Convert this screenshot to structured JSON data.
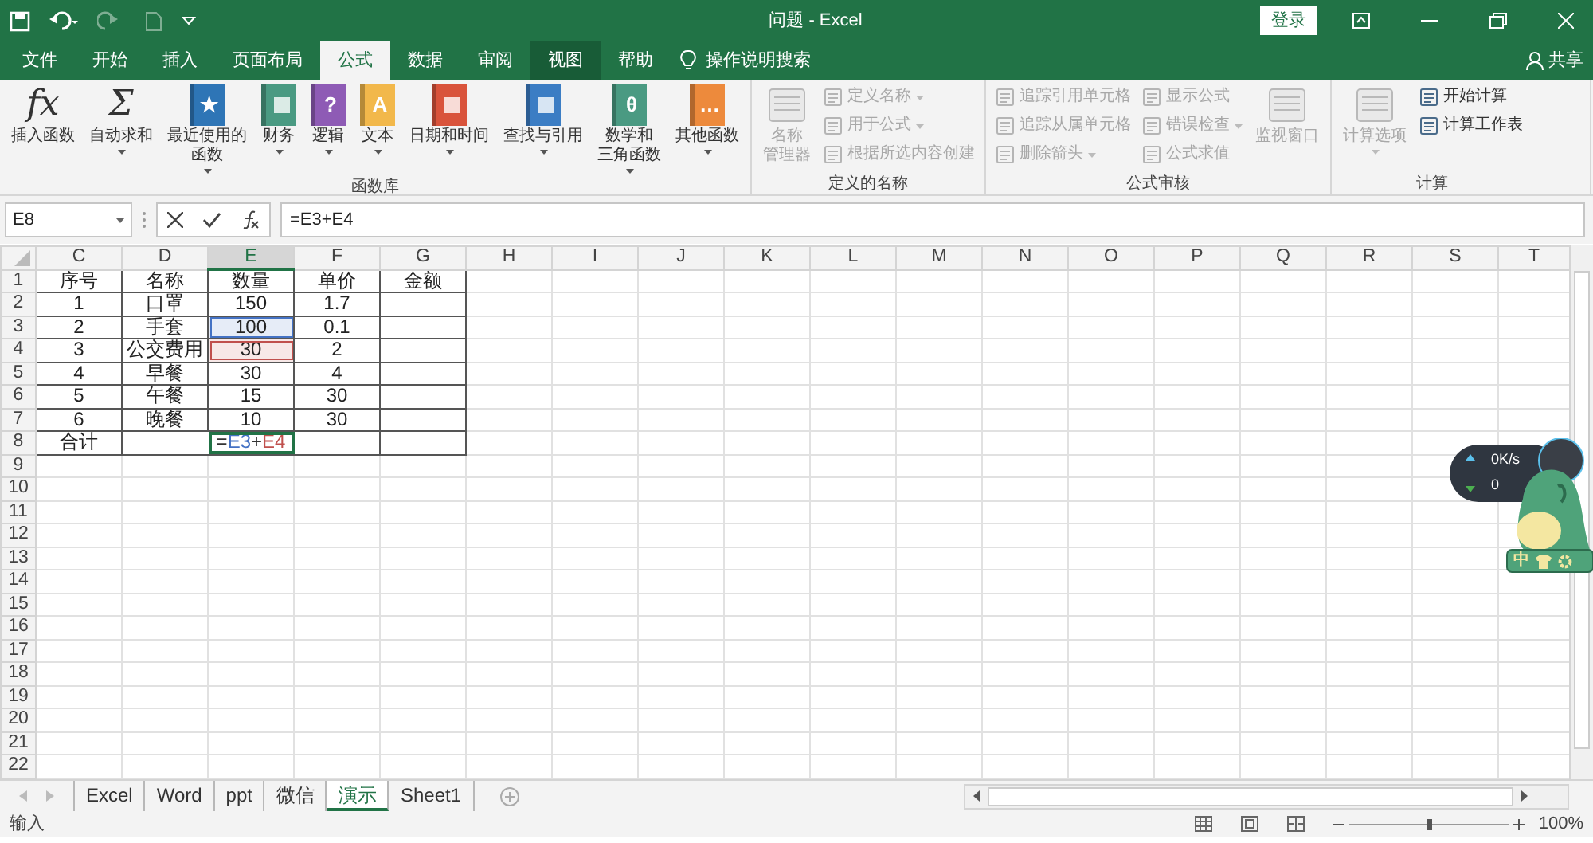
{
  "window": {
    "title": "问题 - Excel",
    "login": "登录"
  },
  "tabs": [
    {
      "label": "文件",
      "selected": false,
      "hovered": false
    },
    {
      "label": "开始",
      "selected": false,
      "hovered": false
    },
    {
      "label": "插入",
      "selected": false,
      "hovered": false
    },
    {
      "label": "页面布局",
      "selected": false,
      "hovered": false
    },
    {
      "label": "公式",
      "selected": true,
      "hovered": false
    },
    {
      "label": "数据",
      "selected": false,
      "hovered": false
    },
    {
      "label": "审阅",
      "selected": false,
      "hovered": false
    },
    {
      "label": "视图",
      "selected": false,
      "hovered": true
    },
    {
      "label": "帮助",
      "selected": false,
      "hovered": false
    }
  ],
  "tell_me": "操作说明搜索",
  "share": "共享",
  "ribbon": {
    "groups": [
      {
        "label": "函数库",
        "buttons": [
          {
            "kind": "glyph",
            "glyph": "fx",
            "label_lines": [
              "插入函数"
            ],
            "dropdown": false,
            "disabled": false
          },
          {
            "kind": "glyph",
            "glyph": "Σ",
            "label_lines": [
              "自动求和"
            ],
            "dropdown": true,
            "disabled": false
          },
          {
            "kind": "book",
            "glyph": "★",
            "color": "#2e75b6",
            "label_lines": [
              "最近使用的",
              "函数"
            ],
            "dropdown": true,
            "disabled": false
          },
          {
            "kind": "book",
            "color": "#4a9a82",
            "label_lines": [
              "财务"
            ],
            "dropdown": true,
            "disabled": false
          },
          {
            "kind": "book",
            "glyph": "?",
            "color": "#8e5bb5",
            "label_lines": [
              "逻辑"
            ],
            "dropdown": true,
            "disabled": false
          },
          {
            "kind": "book",
            "glyph": "A",
            "color": "#f2b84b",
            "label_lines": [
              "文本"
            ],
            "dropdown": true,
            "disabled": false
          },
          {
            "kind": "book",
            "color": "#d9533b",
            "label_lines": [
              "日期和时间"
            ],
            "dropdown": true,
            "disabled": false
          },
          {
            "kind": "book",
            "color": "#3b7dc4",
            "label_lines": [
              "查找与引用"
            ],
            "dropdown": true,
            "disabled": false
          },
          {
            "kind": "book",
            "glyph": "θ",
            "color": "#4a9a82",
            "label_lines": [
              "数学和",
              "三角函数"
            ],
            "dropdown": true,
            "disabled": false
          },
          {
            "kind": "book",
            "glyph": "…",
            "color": "#ed8a3c",
            "label_lines": [
              "其他函数"
            ],
            "dropdown": true,
            "disabled": false
          }
        ]
      },
      {
        "label": "定义的名称",
        "buttons": [
          {
            "kind": "large",
            "label_lines": [
              "名称",
              "管理器"
            ],
            "dropdown": false,
            "disabled": true
          },
          {
            "kind": "small",
            "label": "定义名称",
            "dropdown": true,
            "disabled": true
          },
          {
            "kind": "small",
            "label": "用于公式",
            "dropdown": true,
            "disabled": true
          },
          {
            "kind": "small",
            "label": "根据所选内容创建",
            "dropdown": false,
            "disabled": true
          }
        ]
      },
      {
        "label": "公式审核",
        "buttons": [
          {
            "kind": "small",
            "label": "追踪引用单元格",
            "dropdown": false,
            "disabled": true
          },
          {
            "kind": "small",
            "label": "追踪从属单元格",
            "dropdown": false,
            "disabled": true
          },
          {
            "kind": "small",
            "label": "删除箭头",
            "dropdown": true,
            "disabled": true
          },
          {
            "kind": "small",
            "label": "显示公式",
            "dropdown": false,
            "disabled": true
          },
          {
            "kind": "small",
            "label": "错误检查",
            "dropdown": true,
            "disabled": true
          },
          {
            "kind": "small",
            "label": "公式求值",
            "dropdown": false,
            "disabled": true
          },
          {
            "kind": "large",
            "label_lines": [
              "监视窗口"
            ],
            "dropdown": false,
            "disabled": true
          }
        ]
      },
      {
        "label": "计算",
        "buttons": [
          {
            "kind": "large",
            "label_lines": [
              "计算选项"
            ],
            "dropdown": true,
            "disabled": true
          },
          {
            "kind": "small",
            "label": "开始计算",
            "dropdown": false,
            "disabled": false
          },
          {
            "kind": "small",
            "label": "计算工作表",
            "dropdown": false,
            "disabled": false
          }
        ]
      }
    ]
  },
  "formula_bar": {
    "name_box": "E8",
    "formula": "=E3+E4"
  },
  "sheet": {
    "columns": [
      {
        "label": "C",
        "selected": false
      },
      {
        "label": "D",
        "selected": false
      },
      {
        "label": "E",
        "selected": true
      },
      {
        "label": "F",
        "selected": false
      },
      {
        "label": "G",
        "selected": false
      },
      {
        "label": "H",
        "selected": false
      },
      {
        "label": "I",
        "selected": false
      },
      {
        "label": "J",
        "selected": false
      },
      {
        "label": "K",
        "selected": false
      },
      {
        "label": "L",
        "selected": false
      },
      {
        "label": "M",
        "selected": false
      },
      {
        "label": "N",
        "selected": false
      },
      {
        "label": "O",
        "selected": false
      },
      {
        "label": "P",
        "selected": false
      },
      {
        "label": "Q",
        "selected": false
      },
      {
        "label": "R",
        "selected": false
      },
      {
        "label": "S",
        "selected": false
      },
      {
        "label": "T",
        "selected": false
      }
    ],
    "rows": [
      {
        "number": "1",
        "cells": [
          {
            "text": "序号"
          },
          {
            "text": "名称"
          },
          {
            "text": "数量"
          },
          {
            "text": "单价"
          },
          {
            "text": "金额"
          }
        ]
      },
      {
        "number": "2",
        "cells": [
          {
            "text": "1"
          },
          {
            "text": "口罩"
          },
          {
            "text": "150"
          },
          {
            "text": "1.7"
          }
        ]
      },
      {
        "number": "3",
        "cells": [
          {
            "text": "2"
          },
          {
            "text": "手套"
          },
          {
            "text": "100",
            "color": "#4472c4"
          },
          {
            "text": "0.1"
          }
        ]
      },
      {
        "number": "4",
        "cells": [
          {
            "text": "3"
          },
          {
            "text": "公交费用"
          },
          {
            "text": "30",
            "color": "#c0504d"
          },
          {
            "text": "2"
          }
        ]
      },
      {
        "number": "5",
        "cells": [
          {
            "text": "4"
          },
          {
            "text": "早餐"
          },
          {
            "text": "30"
          },
          {
            "text": "4"
          }
        ]
      },
      {
        "number": "6",
        "cells": [
          {
            "text": "5"
          },
          {
            "text": "午餐"
          },
          {
            "text": "15"
          },
          {
            "text": "30"
          }
        ]
      },
      {
        "number": "7",
        "cells": [
          {
            "text": "6"
          },
          {
            "text": "晚餐"
          },
          {
            "text": "10"
          },
          {
            "text": "30"
          }
        ]
      }
    ],
    "total_row": {
      "number": "8",
      "label": "合计",
      "active": true,
      "formula_parts": [
        {
          "text": "=",
          "color": "#333333"
        },
        {
          "text": "E3",
          "color": "#4472c4"
        },
        {
          "text": "+",
          "color": "#333333"
        },
        {
          "text": "E4",
          "color": "#c0504d"
        }
      ]
    },
    "empty_rows": [
      "9",
      "10",
      "11",
      "12",
      "13",
      "14",
      "15",
      "16",
      "17",
      "18",
      "19",
      "20",
      "21",
      "22"
    ]
  },
  "sheet_tabs": [
    {
      "label": "Excel",
      "selected": false
    },
    {
      "label": "Word",
      "selected": false
    },
    {
      "label": "ppt",
      "selected": false
    },
    {
      "label": "微信",
      "selected": false
    },
    {
      "label": "演示",
      "selected": true
    },
    {
      "label": "Sheet1",
      "selected": false
    }
  ],
  "status_bar": {
    "mode": "输入",
    "zoom": "100%",
    "zoom_slider": {
      "level": 0.5
    }
  },
  "widget": {
    "upload": "0K/s",
    "download": "0",
    "badge": "中"
  }
}
